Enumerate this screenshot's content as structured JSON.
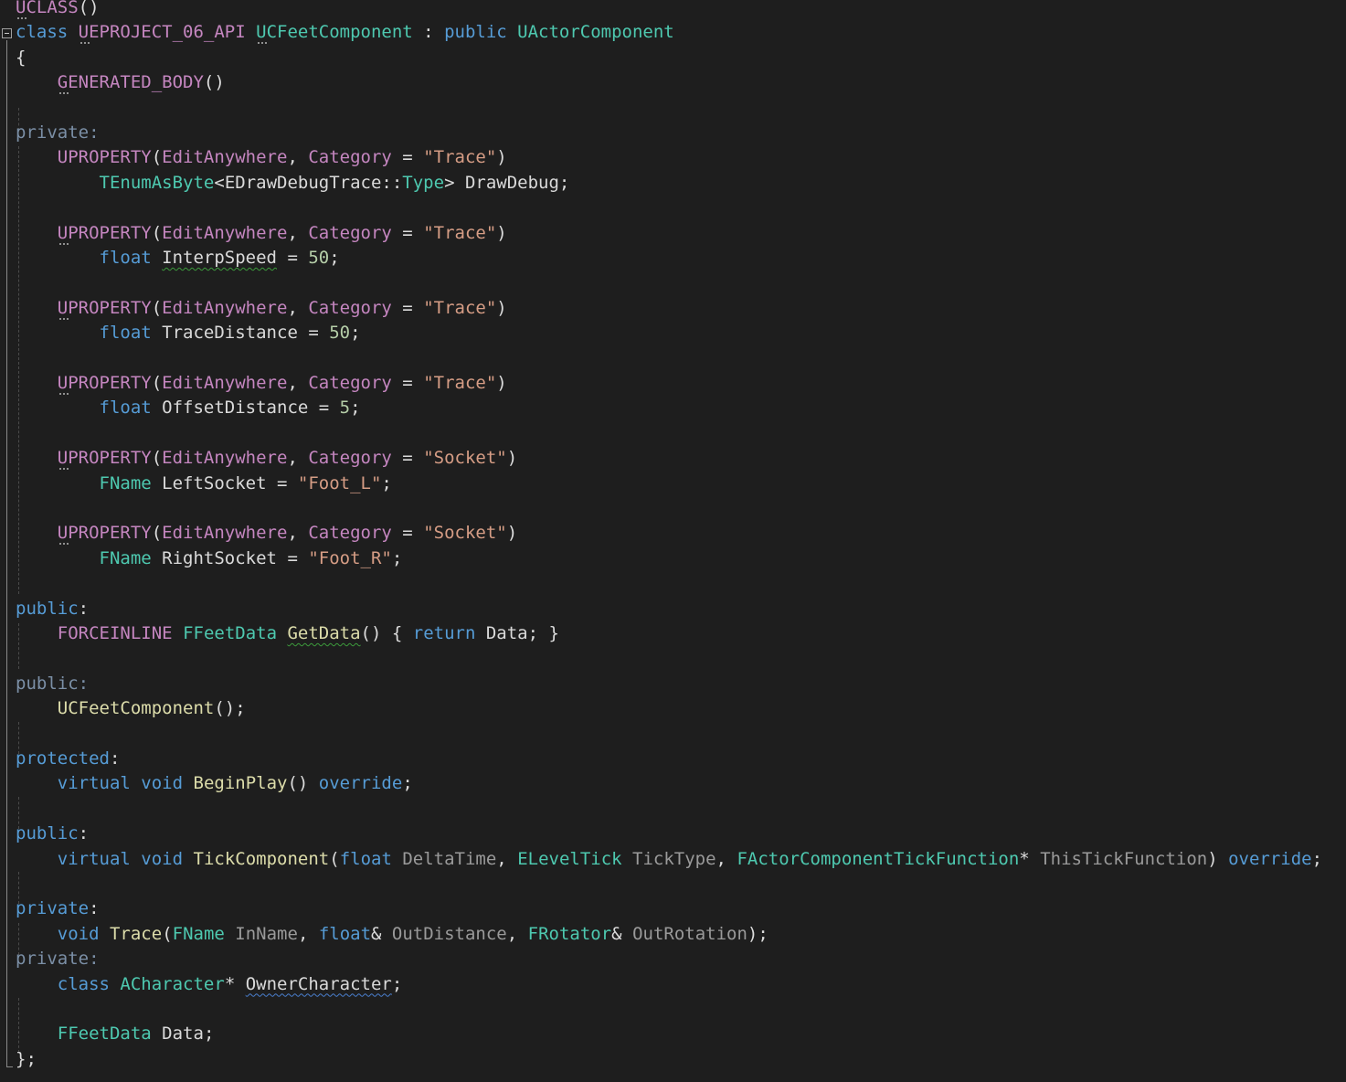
{
  "colors": {
    "background": "#1e1e1e",
    "keyword": "#569cd6",
    "macro": "#c586c0",
    "type": "#4ec9b0",
    "function": "#dcdcaa",
    "string": "#d69d85",
    "number": "#b5cea8",
    "parameter": "#9a9a9a",
    "plain": "#dcdcdc",
    "squiggle_green": "#3c9b3c",
    "squiggle_blue": "#4a7fd0"
  },
  "lines": [
    {
      "y": 0,
      "tokens": [
        {
          "t": "UCLASS",
          "c": "macro",
          "dots": true
        },
        {
          "t": "()",
          "c": "plain"
        }
      ]
    },
    {
      "y": 1,
      "tokens": [
        {
          "t": "class",
          "c": "kw"
        },
        {
          "t": " ",
          "c": "plain"
        },
        {
          "t": "UEPROJECT_06_API",
          "c": "macro",
          "dots": true
        },
        {
          "t": " ",
          "c": "plain"
        },
        {
          "t": "UCFeetComponent",
          "c": "type",
          "dots": true
        },
        {
          "t": " : ",
          "c": "plain"
        },
        {
          "t": "public",
          "c": "kw"
        },
        {
          "t": " ",
          "c": "plain"
        },
        {
          "t": "UActorComponent",
          "c": "type"
        }
      ]
    },
    {
      "y": 2,
      "tokens": [
        {
          "t": "{",
          "c": "plain"
        }
      ]
    },
    {
      "y": 3,
      "tokens": [
        {
          "t": "    ",
          "c": "plain"
        },
        {
          "t": "GENERATED_BODY",
          "c": "macro",
          "dots": true
        },
        {
          "t": "()",
          "c": "plain"
        }
      ]
    },
    {
      "y": 5,
      "tokens": [
        {
          "t": "private",
          "c": "access-dim"
        },
        {
          "t": ":",
          "c": "access-dim"
        }
      ]
    },
    {
      "y": 6,
      "tokens": [
        {
          "t": "    ",
          "c": "plain"
        },
        {
          "t": "UPROPERTY",
          "c": "macro"
        },
        {
          "t": "(",
          "c": "plain"
        },
        {
          "t": "EditAnywhere",
          "c": "macro"
        },
        {
          "t": ", ",
          "c": "plain"
        },
        {
          "t": "Category",
          "c": "macro"
        },
        {
          "t": " = ",
          "c": "plain"
        },
        {
          "t": "\"Trace\"",
          "c": "string"
        },
        {
          "t": ")",
          "c": "plain"
        }
      ]
    },
    {
      "y": 7,
      "tokens": [
        {
          "t": "        ",
          "c": "plain"
        },
        {
          "t": "TEnumAsByte",
          "c": "type"
        },
        {
          "t": "<",
          "c": "plain"
        },
        {
          "t": "EDrawDebugTrace",
          "c": "member"
        },
        {
          "t": "::",
          "c": "plain"
        },
        {
          "t": "Type",
          "c": "type"
        },
        {
          "t": "> ",
          "c": "plain"
        },
        {
          "t": "DrawDebug",
          "c": "member"
        },
        {
          "t": ";",
          "c": "plain"
        }
      ]
    },
    {
      "y": 9,
      "tokens": [
        {
          "t": "    ",
          "c": "plain"
        },
        {
          "t": "UPROPERTY",
          "c": "macro",
          "dots": true
        },
        {
          "t": "(",
          "c": "plain"
        },
        {
          "t": "EditAnywhere",
          "c": "macro"
        },
        {
          "t": ", ",
          "c": "plain"
        },
        {
          "t": "Category",
          "c": "macro"
        },
        {
          "t": " = ",
          "c": "plain"
        },
        {
          "t": "\"Trace\"",
          "c": "string"
        },
        {
          "t": ")",
          "c": "plain"
        }
      ]
    },
    {
      "y": 10,
      "tokens": [
        {
          "t": "        ",
          "c": "plain"
        },
        {
          "t": "float",
          "c": "kw"
        },
        {
          "t": " ",
          "c": "plain"
        },
        {
          "t": "InterpSpeed",
          "c": "member",
          "squiggle": "green"
        },
        {
          "t": " = ",
          "c": "plain"
        },
        {
          "t": "50",
          "c": "number"
        },
        {
          "t": ";",
          "c": "plain"
        }
      ]
    },
    {
      "y": 12,
      "tokens": [
        {
          "t": "    ",
          "c": "plain"
        },
        {
          "t": "UPROPERTY",
          "c": "macro",
          "dots": true
        },
        {
          "t": "(",
          "c": "plain"
        },
        {
          "t": "EditAnywhere",
          "c": "macro"
        },
        {
          "t": ", ",
          "c": "plain"
        },
        {
          "t": "Category",
          "c": "macro"
        },
        {
          "t": " = ",
          "c": "plain"
        },
        {
          "t": "\"Trace\"",
          "c": "string"
        },
        {
          "t": ")",
          "c": "plain"
        }
      ]
    },
    {
      "y": 13,
      "tokens": [
        {
          "t": "        ",
          "c": "plain"
        },
        {
          "t": "float",
          "c": "kw"
        },
        {
          "t": " ",
          "c": "plain"
        },
        {
          "t": "TraceDistance",
          "c": "member"
        },
        {
          "t": " = ",
          "c": "plain"
        },
        {
          "t": "50",
          "c": "number"
        },
        {
          "t": ";",
          "c": "plain"
        }
      ]
    },
    {
      "y": 15,
      "tokens": [
        {
          "t": "    ",
          "c": "plain"
        },
        {
          "t": "UPROPERTY",
          "c": "macro",
          "dots": true
        },
        {
          "t": "(",
          "c": "plain"
        },
        {
          "t": "EditAnywhere",
          "c": "macro"
        },
        {
          "t": ", ",
          "c": "plain"
        },
        {
          "t": "Category",
          "c": "macro"
        },
        {
          "t": " = ",
          "c": "plain"
        },
        {
          "t": "\"Trace\"",
          "c": "string"
        },
        {
          "t": ")",
          "c": "plain"
        }
      ]
    },
    {
      "y": 16,
      "tokens": [
        {
          "t": "        ",
          "c": "plain"
        },
        {
          "t": "float",
          "c": "kw"
        },
        {
          "t": " ",
          "c": "plain"
        },
        {
          "t": "OffsetDistance",
          "c": "member"
        },
        {
          "t": " = ",
          "c": "plain"
        },
        {
          "t": "5",
          "c": "number"
        },
        {
          "t": ";",
          "c": "plain"
        }
      ]
    },
    {
      "y": 18,
      "tokens": [
        {
          "t": "    ",
          "c": "plain"
        },
        {
          "t": "UPROPERTY",
          "c": "macro",
          "dots": true
        },
        {
          "t": "(",
          "c": "plain"
        },
        {
          "t": "EditAnywhere",
          "c": "macro"
        },
        {
          "t": ", ",
          "c": "plain"
        },
        {
          "t": "Category",
          "c": "macro"
        },
        {
          "t": " = ",
          "c": "plain"
        },
        {
          "t": "\"Socket\"",
          "c": "string"
        },
        {
          "t": ")",
          "c": "plain"
        }
      ]
    },
    {
      "y": 19,
      "tokens": [
        {
          "t": "        ",
          "c": "plain"
        },
        {
          "t": "FName",
          "c": "type"
        },
        {
          "t": " ",
          "c": "plain"
        },
        {
          "t": "LeftSocket",
          "c": "member"
        },
        {
          "t": " = ",
          "c": "plain"
        },
        {
          "t": "\"Foot_L\"",
          "c": "string"
        },
        {
          "t": ";",
          "c": "plain"
        }
      ]
    },
    {
      "y": 21,
      "tokens": [
        {
          "t": "    ",
          "c": "plain"
        },
        {
          "t": "UPROPERTY",
          "c": "macro",
          "dots": true
        },
        {
          "t": "(",
          "c": "plain"
        },
        {
          "t": "EditAnywhere",
          "c": "macro"
        },
        {
          "t": ", ",
          "c": "plain"
        },
        {
          "t": "Category",
          "c": "macro"
        },
        {
          "t": " = ",
          "c": "plain"
        },
        {
          "t": "\"Socket\"",
          "c": "string"
        },
        {
          "t": ")",
          "c": "plain"
        }
      ]
    },
    {
      "y": 22,
      "tokens": [
        {
          "t": "        ",
          "c": "plain"
        },
        {
          "t": "FName",
          "c": "type"
        },
        {
          "t": " ",
          "c": "plain"
        },
        {
          "t": "RightSocket",
          "c": "member"
        },
        {
          "t": " = ",
          "c": "plain"
        },
        {
          "t": "\"Foot_R\"",
          "c": "string"
        },
        {
          "t": ";",
          "c": "plain"
        }
      ]
    },
    {
      "y": 24,
      "tokens": [
        {
          "t": "public",
          "c": "kw"
        },
        {
          "t": ":",
          "c": "plain"
        }
      ]
    },
    {
      "y": 25,
      "tokens": [
        {
          "t": "    ",
          "c": "plain"
        },
        {
          "t": "FORCEINLINE",
          "c": "macro"
        },
        {
          "t": " ",
          "c": "plain"
        },
        {
          "t": "FFeetData",
          "c": "type"
        },
        {
          "t": " ",
          "c": "plain"
        },
        {
          "t": "GetData",
          "c": "func",
          "squiggle": "green"
        },
        {
          "t": "() { ",
          "c": "plain"
        },
        {
          "t": "return",
          "c": "kw"
        },
        {
          "t": " ",
          "c": "plain"
        },
        {
          "t": "Data",
          "c": "member"
        },
        {
          "t": "; }",
          "c": "plain"
        }
      ]
    },
    {
      "y": 27,
      "tokens": [
        {
          "t": "public",
          "c": "access-dim"
        },
        {
          "t": ":",
          "c": "access-dim"
        }
      ]
    },
    {
      "y": 28,
      "tokens": [
        {
          "t": "    ",
          "c": "plain"
        },
        {
          "t": "UCFeetComponent",
          "c": "func"
        },
        {
          "t": "();",
          "c": "plain"
        }
      ]
    },
    {
      "y": 30,
      "tokens": [
        {
          "t": "protected",
          "c": "kw"
        },
        {
          "t": ":",
          "c": "plain"
        }
      ]
    },
    {
      "y": 31,
      "tokens": [
        {
          "t": "    ",
          "c": "plain"
        },
        {
          "t": "virtual",
          "c": "kw"
        },
        {
          "t": " ",
          "c": "plain"
        },
        {
          "t": "void",
          "c": "kw"
        },
        {
          "t": " ",
          "c": "plain"
        },
        {
          "t": "BeginPlay",
          "c": "func"
        },
        {
          "t": "() ",
          "c": "plain"
        },
        {
          "t": "override",
          "c": "kw"
        },
        {
          "t": ";",
          "c": "plain"
        }
      ]
    },
    {
      "y": 33,
      "tokens": [
        {
          "t": "public",
          "c": "kw"
        },
        {
          "t": ":",
          "c": "plain"
        }
      ]
    },
    {
      "y": 34,
      "tokens": [
        {
          "t": "    ",
          "c": "plain"
        },
        {
          "t": "virtual",
          "c": "kw"
        },
        {
          "t": " ",
          "c": "plain"
        },
        {
          "t": "void",
          "c": "kw"
        },
        {
          "t": " ",
          "c": "plain"
        },
        {
          "t": "TickComponent",
          "c": "func"
        },
        {
          "t": "(",
          "c": "plain"
        },
        {
          "t": "float",
          "c": "kw"
        },
        {
          "t": " ",
          "c": "plain"
        },
        {
          "t": "DeltaTime",
          "c": "param"
        },
        {
          "t": ", ",
          "c": "plain"
        },
        {
          "t": "ELevelTick",
          "c": "type"
        },
        {
          "t": " ",
          "c": "plain"
        },
        {
          "t": "TickType",
          "c": "param"
        },
        {
          "t": ", ",
          "c": "plain"
        },
        {
          "t": "FActorComponentTickFunction",
          "c": "type"
        },
        {
          "t": "* ",
          "c": "plain"
        },
        {
          "t": "ThisTickFunction",
          "c": "param"
        },
        {
          "t": ") ",
          "c": "plain"
        },
        {
          "t": "override",
          "c": "kw"
        },
        {
          "t": ";",
          "c": "plain"
        }
      ]
    },
    {
      "y": 36,
      "tokens": [
        {
          "t": "private",
          "c": "kw"
        },
        {
          "t": ":",
          "c": "plain"
        }
      ]
    },
    {
      "y": 37,
      "tokens": [
        {
          "t": "    ",
          "c": "plain"
        },
        {
          "t": "void",
          "c": "kw"
        },
        {
          "t": " ",
          "c": "plain"
        },
        {
          "t": "Trace",
          "c": "func"
        },
        {
          "t": "(",
          "c": "plain"
        },
        {
          "t": "FName",
          "c": "type"
        },
        {
          "t": " ",
          "c": "plain"
        },
        {
          "t": "InName",
          "c": "param"
        },
        {
          "t": ", ",
          "c": "plain"
        },
        {
          "t": "float",
          "c": "kw"
        },
        {
          "t": "& ",
          "c": "plain"
        },
        {
          "t": "OutDistance",
          "c": "param"
        },
        {
          "t": ", ",
          "c": "plain"
        },
        {
          "t": "FRotator",
          "c": "type"
        },
        {
          "t": "& ",
          "c": "plain"
        },
        {
          "t": "OutRotation",
          "c": "param"
        },
        {
          "t": ");",
          "c": "plain"
        }
      ]
    },
    {
      "y": 38,
      "tokens": [
        {
          "t": "private",
          "c": "access-dim"
        },
        {
          "t": ":",
          "c": "access-dim"
        }
      ]
    },
    {
      "y": 39,
      "tokens": [
        {
          "t": "    ",
          "c": "plain"
        },
        {
          "t": "class",
          "c": "kw"
        },
        {
          "t": " ",
          "c": "plain"
        },
        {
          "t": "ACharacter",
          "c": "type"
        },
        {
          "t": "* ",
          "c": "plain"
        },
        {
          "t": "OwnerCharacter",
          "c": "member",
          "squiggle": "blue"
        },
        {
          "t": ";",
          "c": "plain"
        }
      ]
    },
    {
      "y": 41,
      "tokens": [
        {
          "t": "    ",
          "c": "plain"
        },
        {
          "t": "FFeetData",
          "c": "type"
        },
        {
          "t": " ",
          "c": "plain"
        },
        {
          "t": "Data",
          "c": "member"
        },
        {
          "t": ";",
          "c": "plain"
        }
      ]
    },
    {
      "y": 42,
      "tokens": [
        {
          "t": "};",
          "c": "plain"
        }
      ]
    }
  ]
}
